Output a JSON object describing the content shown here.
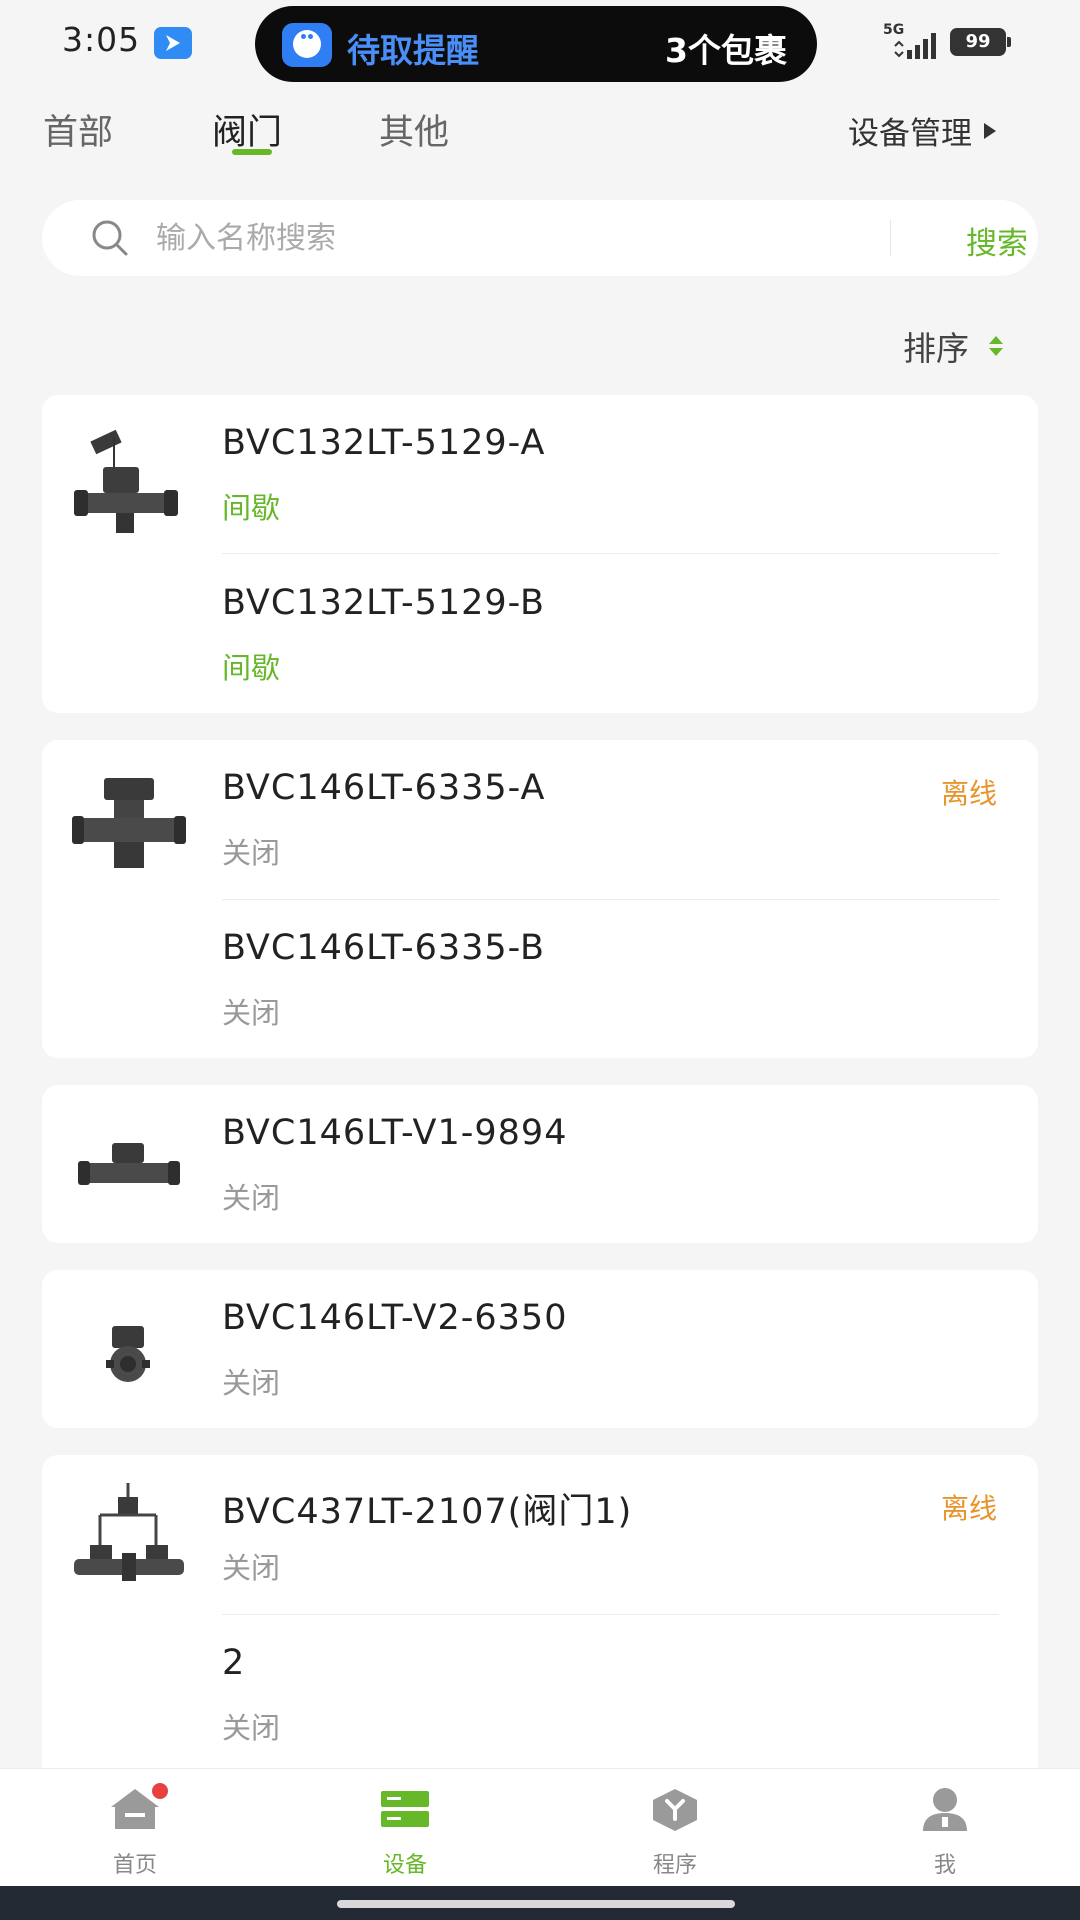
{
  "status_bar": {
    "time": "3:05",
    "network_label": "5G",
    "battery": "99",
    "notification": {
      "title": "待取提醒",
      "count": "3个包裹"
    }
  },
  "tabs": [
    {
      "label": "首部",
      "active": false
    },
    {
      "label": "阀门",
      "active": true
    },
    {
      "label": "其他",
      "active": false
    }
  ],
  "device_mgmt_label": "设备管理",
  "search": {
    "placeholder": "输入名称搜索",
    "value": "",
    "button_label": "搜索"
  },
  "sort_label": "排序",
  "colors": {
    "accent": "#66b829",
    "offline": "#e8942c",
    "status_gray": "#999999"
  },
  "devices": [
    {
      "icon": "solar-valve-icon",
      "channels": [
        {
          "name": "BVC132LT-5129-A",
          "status": "间歇",
          "status_tone": "green"
        },
        {
          "name": "BVC132LT-5129-B",
          "status": "间歇",
          "status_tone": "green"
        }
      ]
    },
    {
      "icon": "double-valve-icon",
      "offline_label": "离线",
      "channels": [
        {
          "name": "BVC146LT-6335-A",
          "status": "关闭",
          "status_tone": "gray"
        },
        {
          "name": "BVC146LT-6335-B",
          "status": "关闭",
          "status_tone": "gray"
        }
      ]
    },
    {
      "icon": "ball-valve-icon",
      "channels": [
        {
          "name": "BVC146LT-V1-9894",
          "status": "关闭",
          "status_tone": "gray"
        }
      ]
    },
    {
      "icon": "flange-valve-icon",
      "channels": [
        {
          "name": "BVC146LT-V2-6350",
          "status": "关闭",
          "status_tone": "gray"
        }
      ]
    },
    {
      "icon": "pipe-valve-icon",
      "offline_label": "离线",
      "channels": [
        {
          "name": "BVC437LT-2107(阀门1)",
          "status": "关闭",
          "status_tone": "gray"
        },
        {
          "name": "2",
          "status": "关闭",
          "status_tone": "gray"
        }
      ]
    }
  ],
  "bottom_nav": [
    {
      "label": "首页",
      "icon": "home-icon",
      "active": false,
      "badge": true
    },
    {
      "label": "设备",
      "icon": "device-icon",
      "active": true,
      "badge": false
    },
    {
      "label": "程序",
      "icon": "program-icon",
      "active": false,
      "badge": false
    },
    {
      "label": "我",
      "icon": "user-icon",
      "active": false,
      "badge": false
    }
  ]
}
